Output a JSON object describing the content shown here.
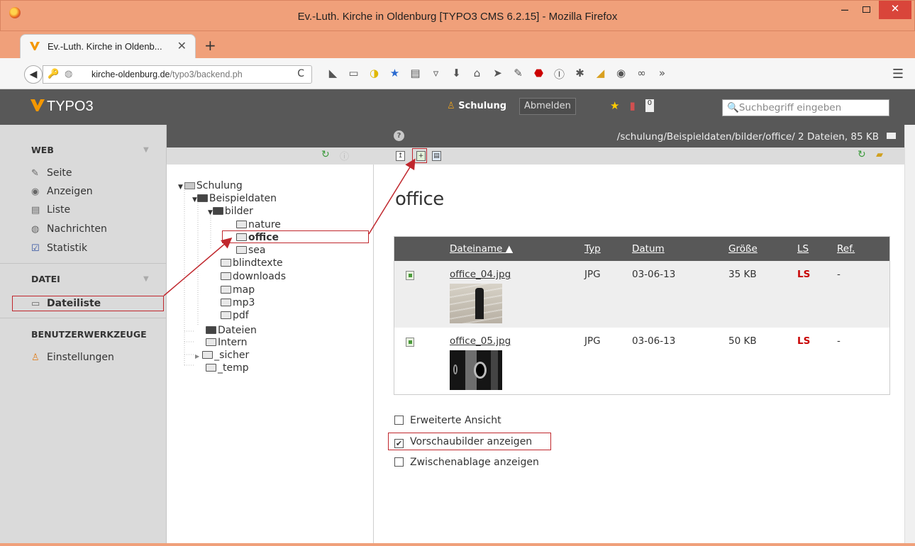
{
  "window": {
    "title": "Ev.-Luth. Kirche in Oldenburg [TYPO3 CMS 6.2.15] - Mozilla Firefox",
    "min": "–",
    "close": "✕"
  },
  "tab": {
    "label": "Ev.-Luth. Kirche in Oldenb...",
    "close": "✕",
    "new": "+"
  },
  "nav": {
    "url_host": "kirche-oldenburg.de",
    "url_path": "/typo3/backend.ph",
    "reload": "C"
  },
  "typo3": {
    "logo": "TYPO3",
    "user": "Schulung",
    "logout": "Abmelden",
    "badge": "0",
    "search_placeholder": "Suchbegriff eingeben"
  },
  "modules": {
    "groups": [
      {
        "label": "WEB"
      },
      {
        "label": "DATEI"
      },
      {
        "label": "BENUTZERWERKZEUGE"
      }
    ],
    "items": [
      {
        "label": "Seite",
        "icon": "pencil-icon"
      },
      {
        "label": "Anzeigen",
        "icon": "eye-icon"
      },
      {
        "label": "Liste",
        "icon": "list-icon"
      },
      {
        "label": "Nachrichten",
        "icon": "globe-icon"
      },
      {
        "label": "Statistik",
        "icon": "chart-icon"
      },
      {
        "label": "Dateiliste",
        "icon": "folder-icon"
      },
      {
        "label": "Einstellungen",
        "icon": "user-settings-icon"
      }
    ]
  },
  "tree": {
    "nodes": [
      {
        "label": "Schulung"
      },
      {
        "label": "Beispieldaten"
      },
      {
        "label": "bilder"
      },
      {
        "label": "nature"
      },
      {
        "label": "office"
      },
      {
        "label": "sea"
      },
      {
        "label": "blindtexte"
      },
      {
        "label": "downloads"
      },
      {
        "label": "map"
      },
      {
        "label": "mp3"
      },
      {
        "label": "pdf"
      },
      {
        "label": "Dateien"
      },
      {
        "label": "Intern"
      },
      {
        "label": "_sicher"
      },
      {
        "label": "_temp"
      }
    ]
  },
  "main": {
    "path": "/schulung/Beispieldaten/bilder/office/ 2 Dateien, 85 KB",
    "heading": "office",
    "columns": {
      "name": "Dateiname ▲",
      "type": "Typ",
      "date": "Datum",
      "size": "Größe",
      "ls": "LS",
      "ref": "Ref."
    },
    "files": [
      {
        "name": "office_04.jpg",
        "type": "JPG",
        "date": "03-06-13",
        "size": "35 KB",
        "ls": "LS",
        "ref": "-"
      },
      {
        "name": "office_05.jpg",
        "type": "JPG",
        "date": "03-06-13",
        "size": "50 KB",
        "ls": "LS",
        "ref": "-"
      }
    ],
    "options": [
      {
        "label": "Erweiterte Ansicht",
        "checked": false
      },
      {
        "label": "Vorschaubilder anzeigen",
        "checked": true
      },
      {
        "label": "Zwischenablage anzeigen",
        "checked": false
      }
    ]
  },
  "colors": {
    "accent_red": "#c0272d",
    "titlebar": "#f0a07a",
    "typo3_dark": "#585858",
    "ls_red": "#c80000"
  }
}
